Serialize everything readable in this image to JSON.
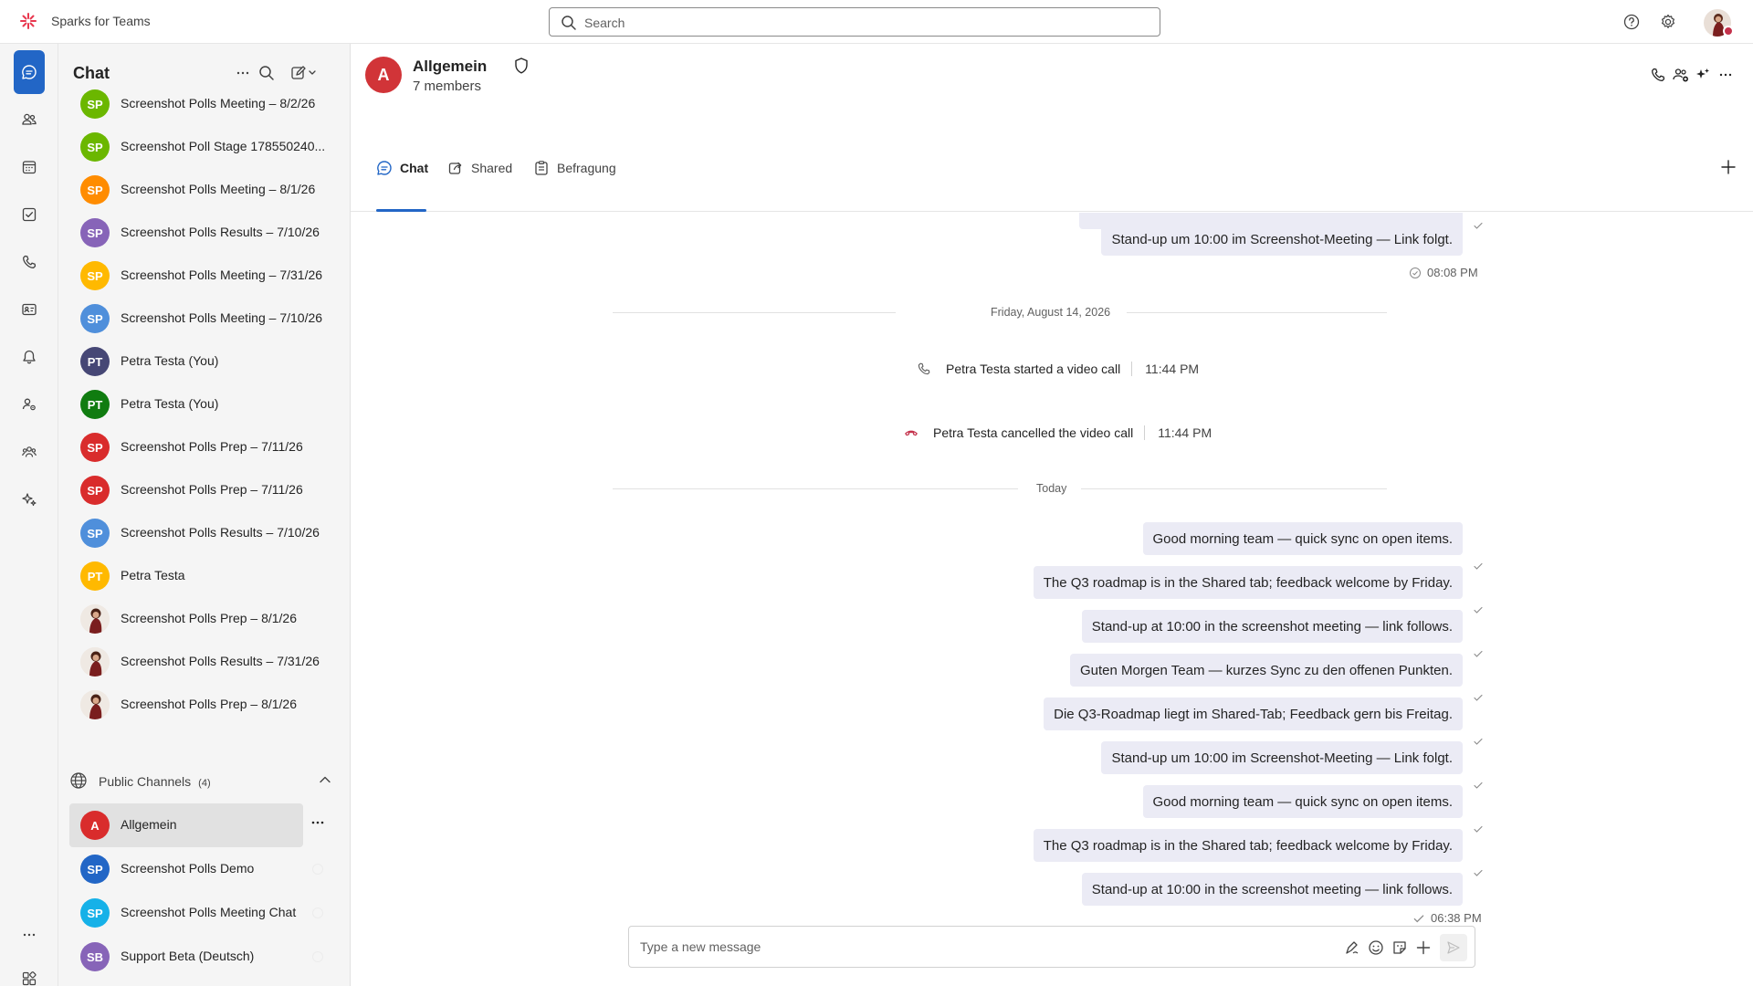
{
  "app": {
    "title": "Sparks for Teams"
  },
  "search": {
    "placeholder": "Search"
  },
  "chat_list": {
    "title": "Chat",
    "items": [
      {
        "initials": "SP",
        "color": "#6bb700",
        "name": "Screenshot Polls Meeting – 8/2/26"
      },
      {
        "initials": "SP",
        "color": "#6bb700",
        "name": "Screenshot Poll Stage 178550240..."
      },
      {
        "initials": "SP",
        "color": "#ff8c00",
        "name": "Screenshot Polls Meeting – 8/1/26"
      },
      {
        "initials": "SP",
        "color": "#8764b8",
        "name": "Screenshot Polls Results – 7/10/26"
      },
      {
        "initials": "SP",
        "color": "#ffb900",
        "name": "Screenshot Polls Meeting – 7/31/26"
      },
      {
        "initials": "SP",
        "color": "#4f8fdb",
        "name": "Screenshot Polls Meeting – 7/10/26"
      },
      {
        "initials": "PT",
        "color": "#464775",
        "name": "Petra Testa (You)"
      },
      {
        "initials": "PT",
        "color": "#107c10",
        "name": "Petra Testa (You)"
      },
      {
        "initials": "SP",
        "color": "#d92c2c",
        "name": "Screenshot Polls Prep – 7/11/26"
      },
      {
        "initials": "SP",
        "color": "#d92c2c",
        "name": "Screenshot Polls Prep – 7/11/26"
      },
      {
        "initials": "SP",
        "color": "#4f8fdb",
        "name": "Screenshot Polls Results – 7/10/26"
      },
      {
        "initials": "PT",
        "color": "#ffb900",
        "name": "Petra Testa"
      },
      {
        "initials": "",
        "color": "",
        "name": "Screenshot Polls Prep – 8/1/26"
      },
      {
        "initials": "",
        "color": "",
        "name": "Screenshot Polls Results – 7/31/26"
      },
      {
        "initials": "",
        "color": "",
        "name": "Screenshot Polls Prep – 8/1/26"
      }
    ],
    "public_channels": {
      "label": "Public Channels",
      "count": "(4)",
      "items": [
        {
          "initials": "A",
          "color": "#d92c2c",
          "name": "Allgemein"
        },
        {
          "initials": "SP",
          "color": "#2266c6",
          "name": "Screenshot Polls Demo"
        },
        {
          "initials": "SP",
          "color": "#16b1e8",
          "name": "Screenshot Polls Meeting Chat"
        },
        {
          "initials": "SB",
          "color": "#8764b8",
          "name": "Support Beta (Deutsch)"
        }
      ]
    }
  },
  "channel": {
    "initial": "A",
    "name": "Allgemein",
    "members": "7 members",
    "tabs": [
      "Chat",
      "Shared",
      "Befragung"
    ]
  },
  "conversation": {
    "top_message": "Stand-up um 10:00 im Screenshot-Meeting — Link folgt.",
    "top_time": "08:08 PM",
    "date_divider": "Friday, August 14, 2026",
    "call_started": {
      "text": "Petra Testa started a video call",
      "time": "11:44 PM"
    },
    "call_cancelled": {
      "text": "Petra Testa cancelled the video call",
      "time": "11:44 PM"
    },
    "today_divider": "Today",
    "messages": [
      "Good morning team — quick sync on open items.",
      "The Q3 roadmap is in the Shared tab; feedback welcome by Friday.",
      "Stand-up at 10:00 in the screenshot meeting — link follows.",
      "Guten Morgen Team — kurzes Sync zu den offenen Punkten.",
      "Die Q3-Roadmap liegt im Shared-Tab; Feedback gern bis Freitag.",
      "Stand-up um 10:00 im Screenshot-Meeting — Link folgt.",
      "Good morning team — quick sync on open items.",
      "The Q3 roadmap is in the Shared tab; feedback welcome by Friday.",
      "Stand-up at 10:00 in the screenshot meeting — link follows."
    ],
    "last_time": "06:38 PM"
  },
  "composer": {
    "placeholder": "Type a new message"
  },
  "colors": {
    "accent": "#2266c6",
    "bubble": "#ebebf5",
    "alert": "#c4314b"
  }
}
